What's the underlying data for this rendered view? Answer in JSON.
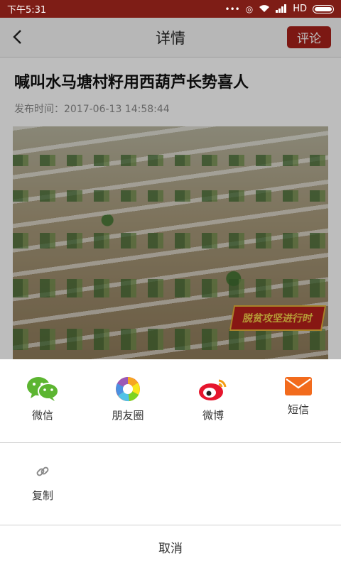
{
  "status_bar": {
    "time": "下午5:31",
    "dots": "•••",
    "network": "HD"
  },
  "nav": {
    "title": "详情",
    "comment_button": "评论"
  },
  "article": {
    "title": "喊叫水马塘村籽用西葫芦长势喜人",
    "publish_time": "发布时间：2017-06-13 14:58:44",
    "image_banner": "脱贫攻坚进行时"
  },
  "share_sheet": {
    "items": [
      {
        "label": "微信",
        "icon": "wechat-icon"
      },
      {
        "label": "朋友圈",
        "icon": "moments-icon"
      },
      {
        "label": "微博",
        "icon": "weibo-icon"
      },
      {
        "label": "短信",
        "icon": "sms-icon"
      }
    ],
    "copy_label": "复制",
    "cancel_label": "取消"
  },
  "colors": {
    "status_bar": "#7e1d16",
    "accent": "#a8211a"
  }
}
